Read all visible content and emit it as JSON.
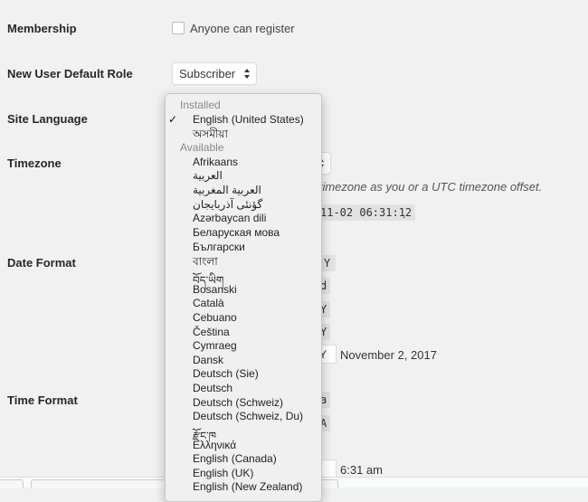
{
  "settings": {
    "membership": {
      "label": "Membership",
      "checkbox_label": "Anyone can register",
      "checked": false
    },
    "default_role": {
      "label": "New User Default Role",
      "value": "Subscriber"
    },
    "site_language": {
      "label": "Site Language",
      "value": "English (United States)"
    },
    "timezone": {
      "label": "Timezone",
      "description_visible": "e timezone as you or a UTC timezone offset.",
      "universal_time_visible": "11-02 06:31:12",
      "trailing_period": "."
    },
    "date_format": {
      "label": "Date Format",
      "option_snippets": [
        "Y",
        "d",
        "Y",
        "Y"
      ],
      "custom_input_visible": "Y",
      "preview": "November 2, 2017"
    },
    "time_format": {
      "label": "Time Format",
      "option_snippets": [
        "a",
        "A"
      ],
      "custom_input_visible": "",
      "preview": "6:31 am"
    }
  },
  "language_dropdown": {
    "groups": [
      {
        "label": "Installed",
        "items": [
          {
            "label": "English (United States)",
            "selected": true
          },
          {
            "label": "অসমীয়া",
            "selected": false
          }
        ]
      },
      {
        "label": "Available",
        "items": [
          {
            "label": "Afrikaans"
          },
          {
            "label": "العربية"
          },
          {
            "label": "العربية المغربية"
          },
          {
            "label": "گؤنئی آذربایجان"
          },
          {
            "label": "Azərbaycan dili"
          },
          {
            "label": "Беларуская мова"
          },
          {
            "label": "Български"
          },
          {
            "label": "বাংলা"
          },
          {
            "label": "བོད་ཡིག"
          },
          {
            "label": "Bosanski"
          },
          {
            "label": "Català"
          },
          {
            "label": "Cebuano"
          },
          {
            "label": "Čeština"
          },
          {
            "label": "Cymraeg"
          },
          {
            "label": "Dansk"
          },
          {
            "label": "Deutsch (Sie)"
          },
          {
            "label": "Deutsch"
          },
          {
            "label": "Deutsch (Schweiz)"
          },
          {
            "label": "Deutsch (Schweiz, Du)"
          },
          {
            "label": "རྫོང་ཁ"
          },
          {
            "label": "Ελληνικά"
          },
          {
            "label": "English (Canada)"
          },
          {
            "label": "English (UK)"
          },
          {
            "label": "English (New Zealand)"
          }
        ]
      }
    ],
    "check_glyph": "✓"
  }
}
